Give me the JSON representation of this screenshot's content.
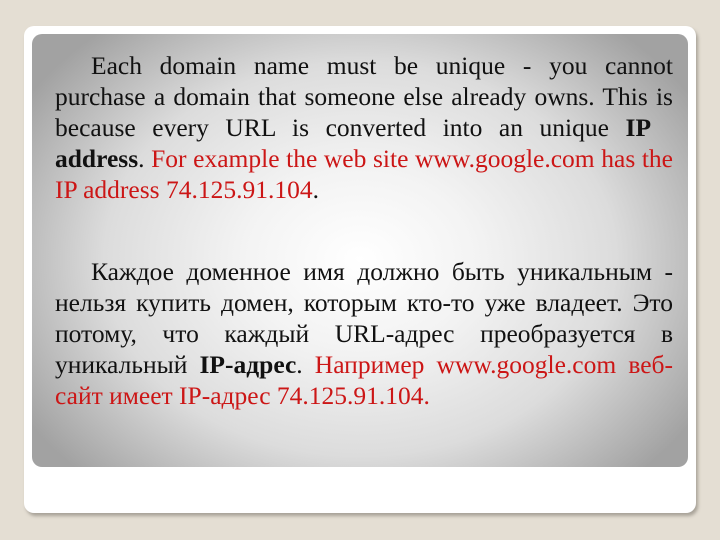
{
  "slide": {
    "paragraphs": [
      {
        "lang": "en",
        "intro": "Each domain name must be unique - you cannot purchase a domain that someone else already owns. This is because every URL is converted into an unique",
        "bold_ip": "IP",
        "bold_term": "address",
        "after_bold": ".",
        "red_text": "For example the web site www.google.com has the IP address 74.125.91.104",
        "end": "."
      },
      {
        "lang": "ru",
        "intro": "Каждое доменное имя должно быть уникальным - нельзя купить домен, которым кто-то уже владеет. Это потому, что каждый URL-адрес преобразуется в уникальный",
        "bold_term": "IP-адрес",
        "after_bold": ".",
        "red_text": "Например www.google.com веб-сайт имеет IP-адрес 74.125.91.104."
      }
    ],
    "colors": {
      "background": "#e4ded3",
      "card": "#ffffff",
      "text": "#111111",
      "highlight": "#cc1616"
    }
  }
}
